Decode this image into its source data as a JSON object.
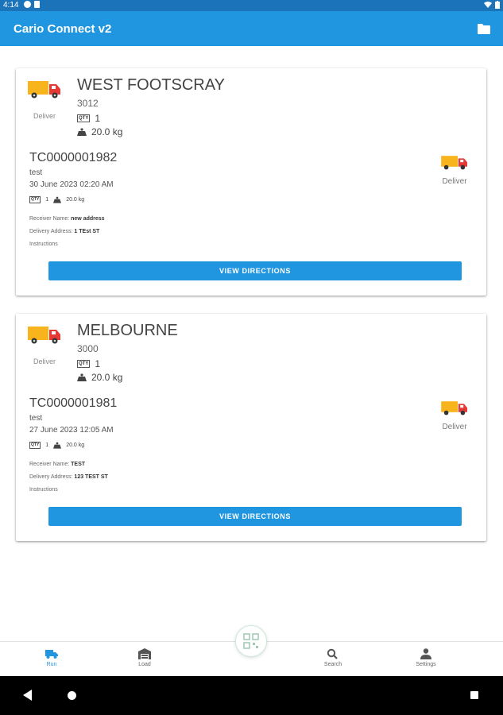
{
  "status_bar": {
    "time": "4:14"
  },
  "app_bar": {
    "title": "Cario Connect v2",
    "action_icon": "folder-icon"
  },
  "cards": [
    {
      "mode": "Deliver",
      "suburb": "WEST FOOTSCRAY",
      "postcode": "3012",
      "qty_label": "QTY",
      "qty": "1",
      "weight": "20.0 kg",
      "consignment": {
        "number": "TC0000001982",
        "description": "test",
        "date": "30 June 2023 02:20 AM",
        "qty_label": "QTY",
        "qty": "1",
        "weight": "20.0 kg",
        "receiver_label": "Receiver Name:",
        "receiver": "new address",
        "address_label": "Delivery Address:",
        "address": "1 TEst ST",
        "instructions_label": "Instructions",
        "mode": "Deliver"
      },
      "button": "VIEW DIRECTIONS"
    },
    {
      "mode": "Deliver",
      "suburb": "MELBOURNE",
      "postcode": "3000",
      "qty_label": "QTY",
      "qty": "1",
      "weight": "20.0 kg",
      "consignment": {
        "number": "TC0000001981",
        "description": "test",
        "date": "27 June 2023 12:05 AM",
        "qty_label": "QTY",
        "qty": "1",
        "weight": "20.0 kg",
        "receiver_label": "Receiver Name:",
        "receiver": "TEST",
        "address_label": "Delivery Address:",
        "address": "123 TEST ST",
        "instructions_label": "Instructions",
        "mode": "Deliver"
      },
      "button": "VIEW DIRECTIONS"
    }
  ],
  "bottom_nav": {
    "items": [
      {
        "label": "Run",
        "icon": "truck-icon",
        "active": true
      },
      {
        "label": "Load",
        "icon": "warehouse-icon",
        "active": false
      },
      {
        "label": "Search",
        "icon": "search-icon",
        "active": false
      },
      {
        "label": "Settings",
        "icon": "person-icon",
        "active": false
      }
    ],
    "center_action": "qr-scan-icon"
  },
  "colors": {
    "primary": "#2196e0",
    "status_bar": "#1b74b9",
    "truck": "#f7b41c",
    "truck_cab": "#e53935"
  }
}
